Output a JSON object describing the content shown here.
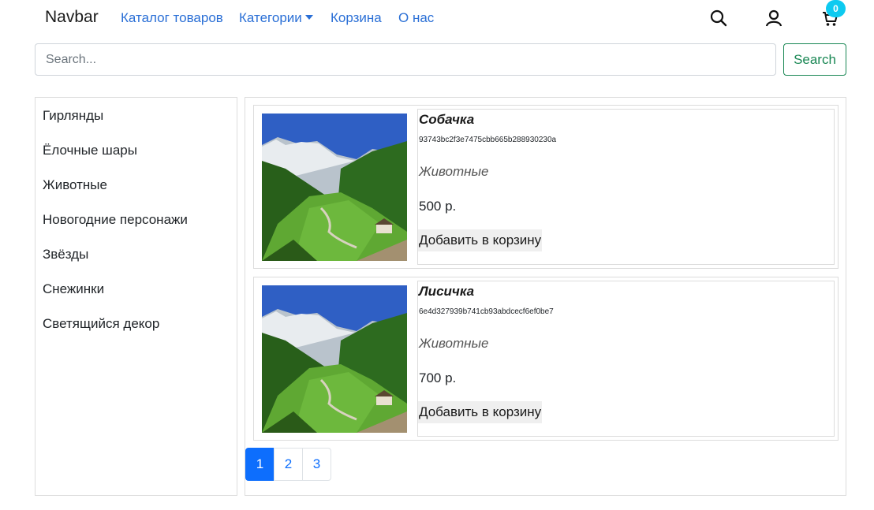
{
  "navbar": {
    "brand": "Navbar",
    "links": [
      "Каталог товаров",
      "Категории",
      "Корзина",
      "О нас"
    ],
    "cart_count": "0",
    "icons": [
      "search-icon",
      "user-icon",
      "cart-icon"
    ]
  },
  "search": {
    "placeholder": "Search...",
    "value": "",
    "button_label": "Search"
  },
  "sidebar": {
    "items": [
      "Гирлянды",
      "Ёлочные шары",
      "Животные",
      "Новогодние персонажи",
      "Звёзды",
      "Снежинки",
      "Светящийся декор"
    ]
  },
  "products": [
    {
      "title": "Собачка",
      "id": "93743bc2f3e7475cbb665b288930230a",
      "category": "Животные",
      "price": "500 р.",
      "add_label": "Добавить в корзину"
    },
    {
      "title": "Лисичка",
      "id": "6e4d327939b741cb93abdcecf6ef0be7",
      "category": "Животные",
      "price": "700 р.",
      "add_label": "Добавить в корзину"
    }
  ],
  "pagination": {
    "pages": [
      "1",
      "2",
      "3"
    ],
    "current": "1"
  },
  "colors": {
    "link": "#2a6fd6",
    "primary": "#0d6efd",
    "success": "#198754",
    "badge": "#0dcaf0"
  }
}
